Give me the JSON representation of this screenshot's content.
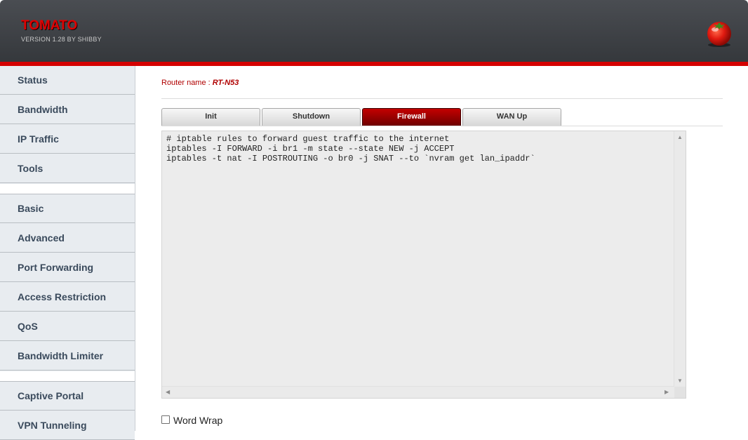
{
  "header": {
    "title": "TOMATO",
    "version": "VERSION 1.28 BY SHIBBY",
    "logo_icon": "tomato-icon",
    "accent_color": "#d40000"
  },
  "sidebar": {
    "items": [
      {
        "label": "Status"
      },
      {
        "label": "Bandwidth"
      },
      {
        "label": "IP Traffic"
      },
      {
        "label": "Tools"
      },
      {
        "label": "Basic"
      },
      {
        "label": "Advanced"
      },
      {
        "label": "Port Forwarding"
      },
      {
        "label": "Access Restriction"
      },
      {
        "label": "QoS"
      },
      {
        "label": "Bandwidth Limiter"
      },
      {
        "label": "Captive Portal"
      },
      {
        "label": "VPN Tunneling"
      }
    ]
  },
  "main": {
    "router_name_label": "Router name :",
    "router_name_value": "RT-N53",
    "tabs": [
      {
        "label": "Init",
        "active": false
      },
      {
        "label": "Shutdown",
        "active": false
      },
      {
        "label": "Firewall",
        "active": true
      },
      {
        "label": "WAN Up",
        "active": false
      }
    ],
    "script": "# iptable rules to forward guest traffic to the internet\niptables -I FORWARD -i br1 -m state --state NEW -j ACCEPT\niptables -t nat -I POSTROUTING -o br0 -j SNAT --to `nvram get lan_ipaddr`",
    "word_wrap_label": "Word Wrap",
    "word_wrap_checked": false
  }
}
